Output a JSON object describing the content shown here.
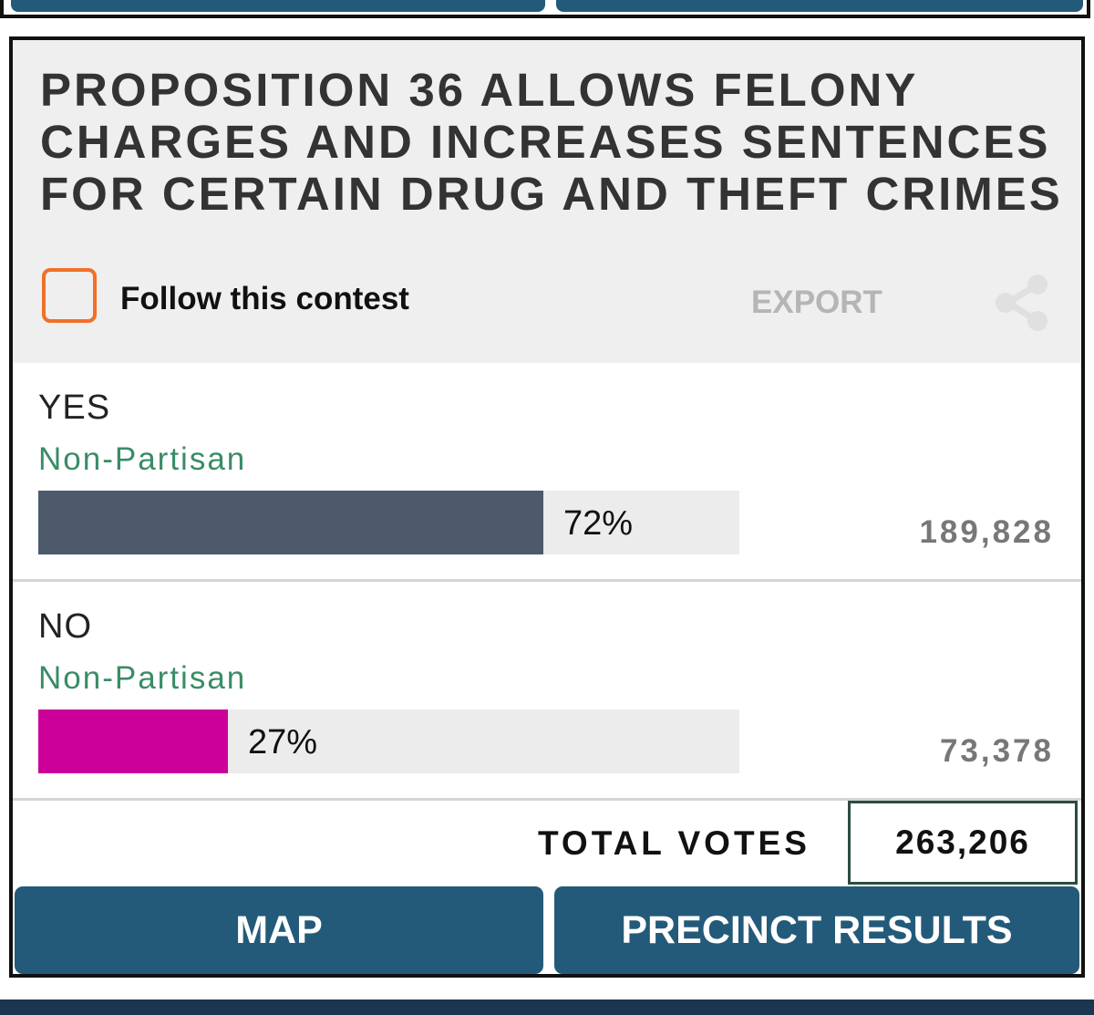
{
  "contest": {
    "title": "PROPOSITION 36 ALLOWS FELONY CHARGES AND INCREASES SENTENCES FOR CERTAIN DRUG AND THEFT CRIMES",
    "follow_label": "Follow this contest",
    "export_label": "EXPORT"
  },
  "choices": [
    {
      "name": "YES",
      "party": "Non-Partisan",
      "percent_label": "72%",
      "percent_value": 72,
      "votes": "189,828",
      "bar_color": "#4d5a6b"
    },
    {
      "name": "NO",
      "party": "Non-Partisan",
      "percent_label": "27%",
      "percent_value": 27,
      "votes": "73,378",
      "bar_color": "#cc0099"
    }
  ],
  "totals": {
    "label": "TOTAL VOTES",
    "value": "263,206"
  },
  "actions": {
    "map_label": "MAP",
    "precinct_label": "PRECINCT RESULTS"
  },
  "icons": {
    "share": "share-icon",
    "follow": "checkbox-icon"
  },
  "colors": {
    "button": "#235a7a",
    "party": "#3a8c66",
    "follow_border": "#f07028"
  }
}
